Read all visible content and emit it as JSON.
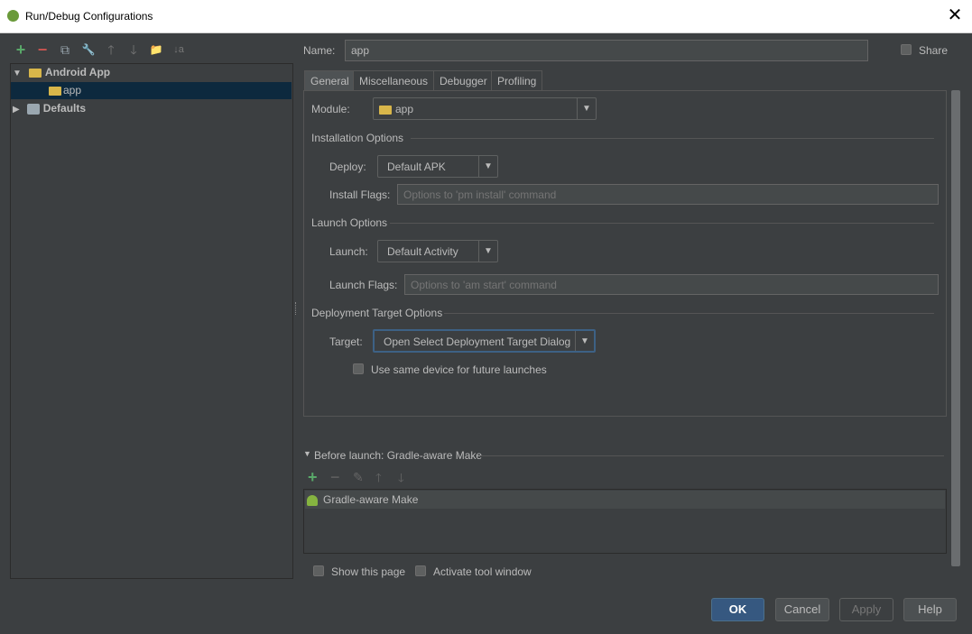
{
  "window": {
    "title": "Run/Debug Configurations",
    "close_glyph": "✕"
  },
  "toolbar": {
    "add": "+",
    "remove": "−",
    "copy": "⧉",
    "edit_defaults": "🔧",
    "move_up": "🡑",
    "move_down": "🡓",
    "folder": "📁",
    "sort": "↓a"
  },
  "tree": {
    "group_arrow_expanded": "▼",
    "group": "Android App",
    "item": "app",
    "defaults_arrow_collapsed": "▶",
    "defaults": "Defaults"
  },
  "name": {
    "label": "Name:",
    "value": "app"
  },
  "share": {
    "label": "Share",
    "checked": false
  },
  "tabs": [
    "General",
    "Miscellaneous",
    "Debugger",
    "Profiling"
  ],
  "general": {
    "module_label": "Module:",
    "module_value": "app",
    "installation_title": "Installation Options",
    "deploy_label": "Deploy:",
    "deploy_value": "Default APK",
    "install_flags_label": "Install Flags:",
    "install_flags_placeholder": "Options to 'pm install' command",
    "launch_title": "Launch Options",
    "launch_label": "Launch:",
    "launch_value": "Default Activity",
    "launch_flags_label": "Launch Flags:",
    "launch_flags_placeholder": "Options to 'am start' command",
    "deployment_title": "Deployment Target Options",
    "target_label": "Target:",
    "target_value": "Open Select Deployment Target Dialog",
    "same_device_label": "Use same device for future launches",
    "same_device_checked": false
  },
  "before_launch": {
    "arrow": "▼",
    "title": "Before launch: Gradle-aware Make",
    "toolbar": {
      "add": "+",
      "remove": "−",
      "edit": "✎",
      "up": "🡑",
      "down": "🡓"
    },
    "items": [
      "Gradle-aware Make"
    ]
  },
  "footer": {
    "show_page_label": "Show this page",
    "activate_label": "Activate tool window"
  },
  "buttons": {
    "ok": "OK",
    "cancel": "Cancel",
    "apply": "Apply",
    "help": "Help"
  },
  "colors": {
    "accent_add": "#59a869",
    "accent_remove": "#c75450",
    "selection": "#0d293e",
    "default_button": "#365880"
  }
}
